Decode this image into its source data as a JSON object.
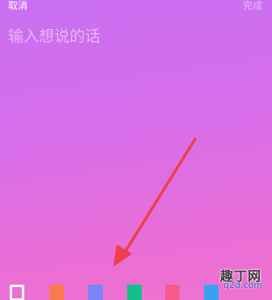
{
  "header": {
    "cancel_label": "取消",
    "done_label": "完成"
  },
  "editor": {
    "placeholder": "输入想说的话"
  },
  "swatches": [
    {
      "color": "#ffffff",
      "selected": true
    },
    {
      "color": "#fb7a4d",
      "selected": false
    },
    {
      "color": "#7a86f6",
      "selected": false
    },
    {
      "color": "#13c186",
      "selected": false
    },
    {
      "color": "#f65a8c",
      "selected": false
    },
    {
      "color": "#3aa0f2",
      "selected": false
    }
  ],
  "annotation": {
    "arrow_color": "#ee3f4a"
  },
  "watermark": {
    "title": "趣丁网",
    "domain": "q2d.com"
  }
}
